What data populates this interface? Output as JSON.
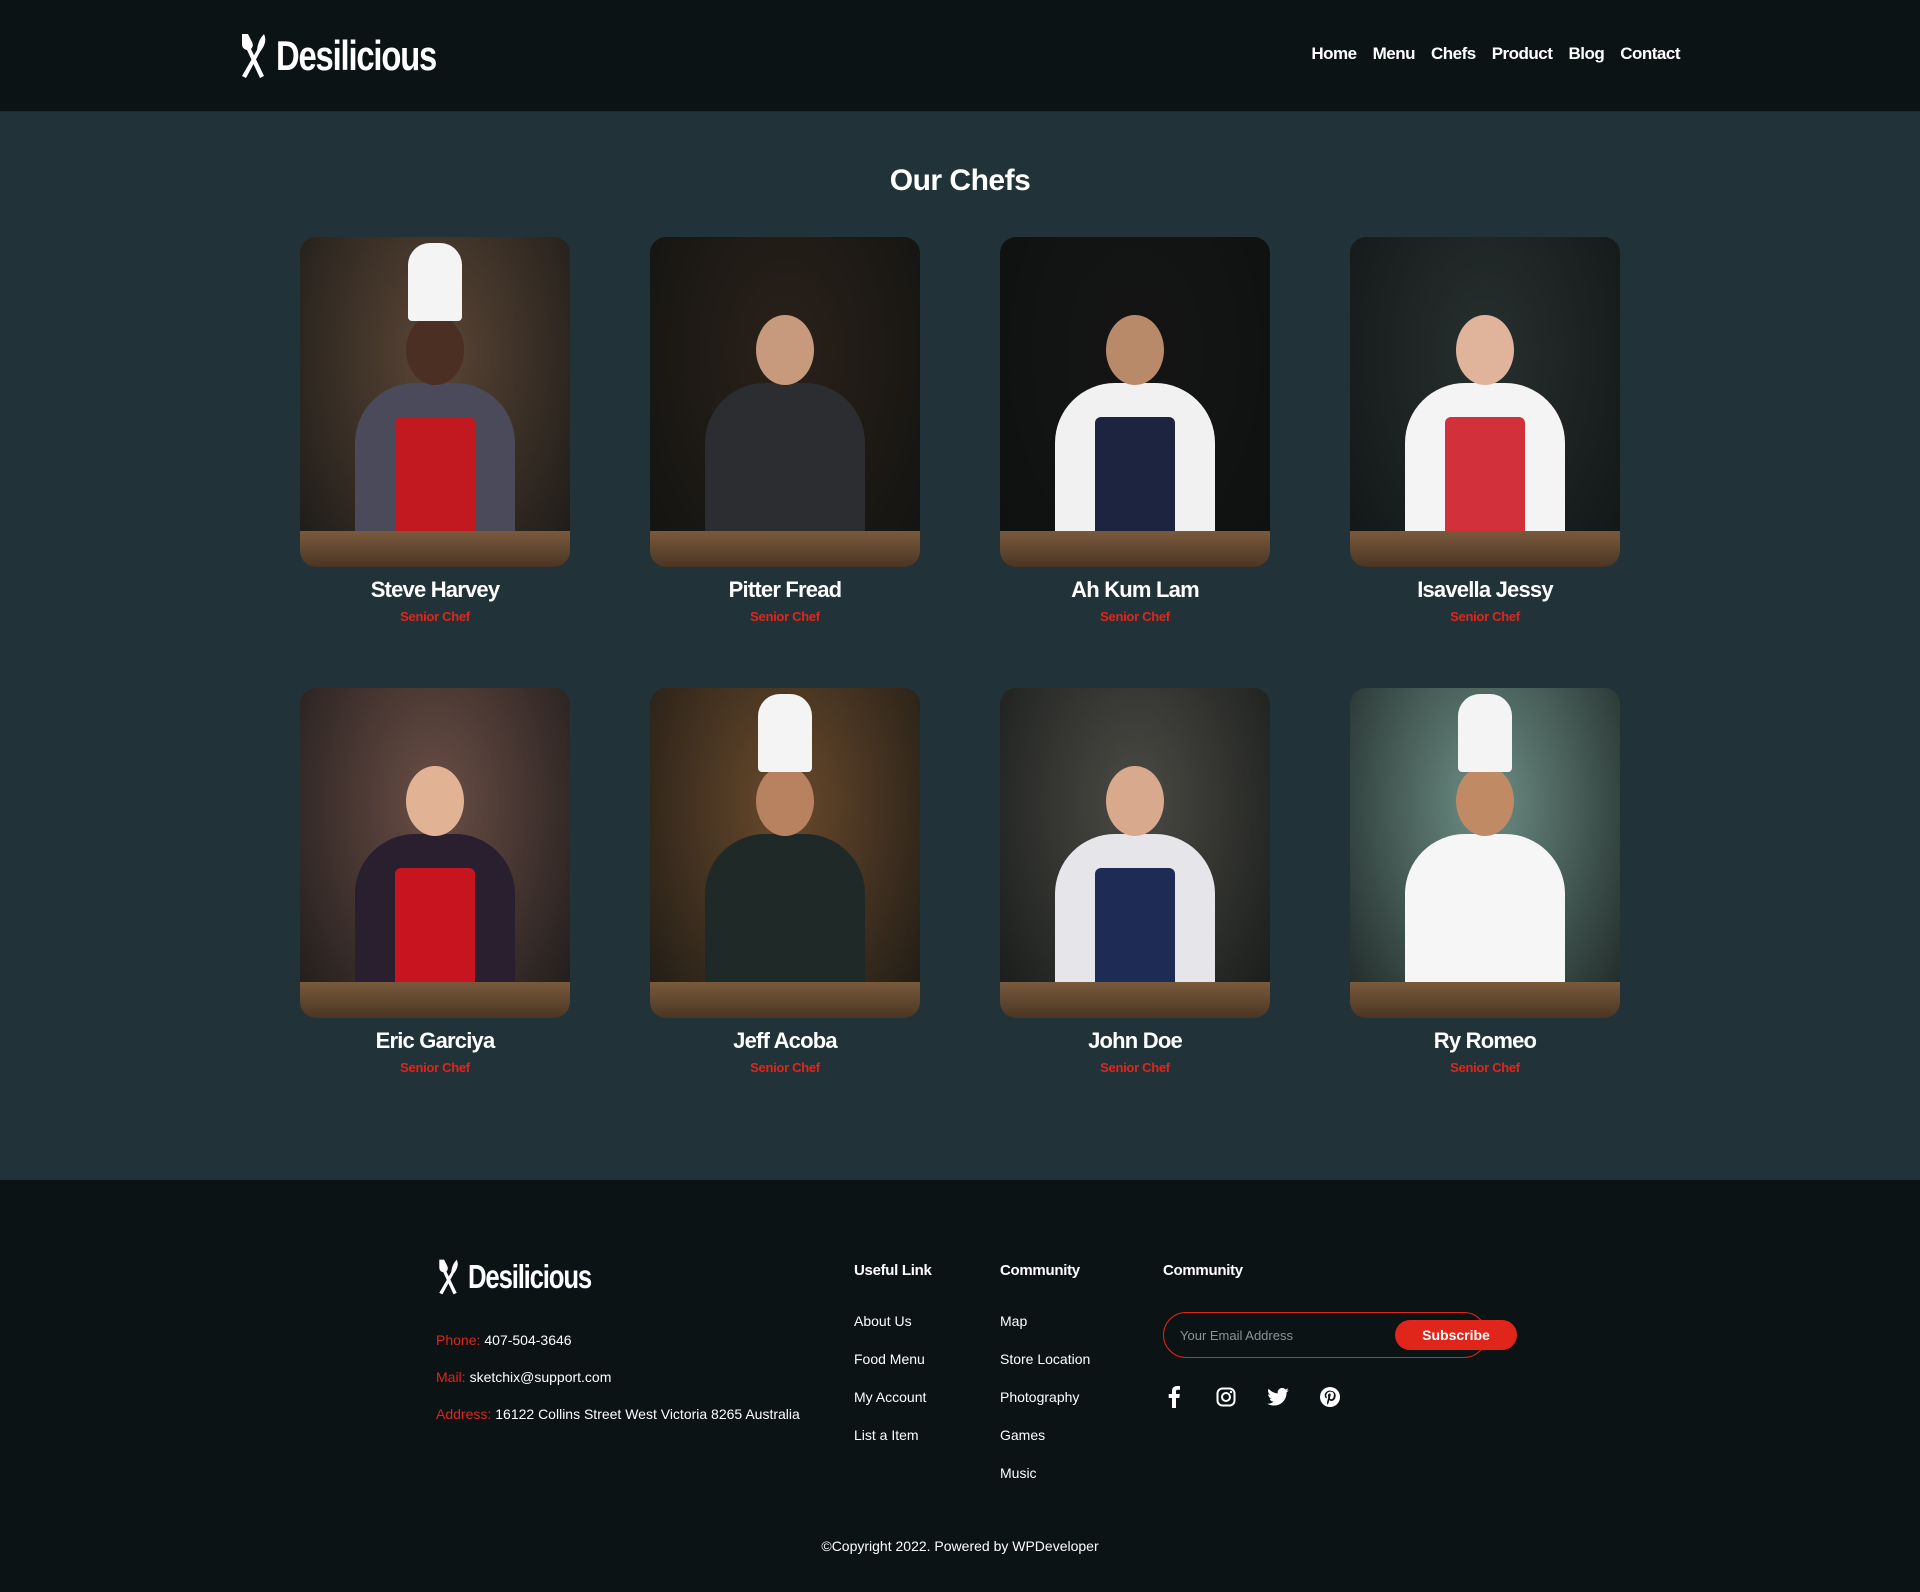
{
  "brand": {
    "name": "Desilicious"
  },
  "nav": {
    "items": [
      "Home",
      "Menu",
      "Chefs",
      "Product",
      "Blog",
      "Contact"
    ]
  },
  "section": {
    "title": "Our Chefs"
  },
  "chefs": [
    {
      "name": "Steve Harvey",
      "role": "Senior Chef",
      "palette": {
        "bg": "#5b4636",
        "skin": "#4a2f22",
        "shirt": "#4b4a5a",
        "apron": "#c2181f",
        "hat": true
      }
    },
    {
      "name": "Pitter Fread",
      "role": "Senior Chef",
      "palette": {
        "bg": "#2a2119",
        "skin": "#c79a7e",
        "shirt": "#2b2d30",
        "apron": "#2b2d30",
        "hat": false
      }
    },
    {
      "name": "Ah Kum Lam",
      "role": "Senior Chef",
      "palette": {
        "bg": "#151515",
        "skin": "#b98a6a",
        "shirt": "#f1f1f1",
        "apron": "#1c2440",
        "hat": false
      }
    },
    {
      "name": "Isavella Jessy",
      "role": "Senior Chef",
      "palette": {
        "bg": "#27302f",
        "skin": "#e0b49a",
        "shirt": "#f4f4f4",
        "apron": "#d2303a",
        "hat": false
      }
    },
    {
      "name": "Eric Garciya",
      "role": "Senior Chef",
      "palette": {
        "bg": "#6b4e46",
        "skin": "#e2b294",
        "shirt": "#2a1f2e",
        "apron": "#c8141e",
        "hat": false
      }
    },
    {
      "name": "Jeff Acoba",
      "role": "Senior Chef",
      "palette": {
        "bg": "#6a4a2c",
        "skin": "#b88260",
        "shirt": "#1f2a28",
        "apron": "#1f2a28",
        "hat": true
      }
    },
    {
      "name": "John Doe",
      "role": "Senior Chef",
      "palette": {
        "bg": "#4b4b45",
        "skin": "#d8a98c",
        "shirt": "#e6e6ea",
        "apron": "#1e2c55",
        "hat": false
      }
    },
    {
      "name": "Ry Romeo",
      "role": "Senior Chef",
      "palette": {
        "bg": "#6d8f86",
        "skin": "#c08b64",
        "shirt": "#f6f6f6",
        "apron": "#f6f6f6",
        "hat": true
      }
    }
  ],
  "footer": {
    "contact": {
      "phone_label": "Phone:",
      "phone": "407-504-3646",
      "mail_label": "Mail:",
      "mail": "sketchix@support.com",
      "address_label": "Address:",
      "address": "16122 Collins Street West Victoria 8265 Australia"
    },
    "useful_links": {
      "title": "Useful Link",
      "items": [
        "About Us",
        "Food Menu",
        "My Account",
        "List a Item"
      ]
    },
    "community": {
      "title": "Community",
      "items": [
        "Map",
        "Store Location",
        "Photography",
        "Games",
        "Music"
      ]
    },
    "newsletter": {
      "title": "Community",
      "placeholder": "Your Email Address",
      "button": "Subscribe"
    },
    "socials": [
      "facebook-icon",
      "instagram-icon",
      "twitter-icon",
      "pinterest-icon"
    ],
    "copyright": "©Copyright 2022. Powered by WPDeveloper"
  },
  "colors": {
    "accent": "#e0251b",
    "header_bg": "#0b1315",
    "page_bg": "#213338"
  }
}
